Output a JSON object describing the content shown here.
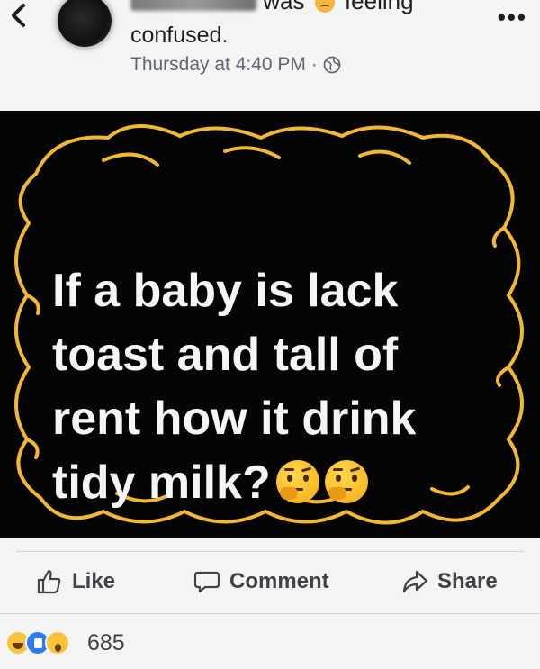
{
  "header": {
    "back_icon": "chevron-left-icon",
    "top_line_was": "was",
    "top_line_feeling": "feeling",
    "feeling_label": "confused.",
    "timestamp": "Thursday at 4:40 PM ·",
    "privacy_icon": "globe-icon",
    "more_label": "•••"
  },
  "post": {
    "image_text_lines": "If a baby is lack\ntoast and tall of\nrent how it drink\ntidy milk?",
    "emoji_count": 2,
    "frame_color": "#f2b733",
    "background_color": "#050505",
    "text_color": "#f5f5f5"
  },
  "actions": {
    "like_label": "Like",
    "comment_label": "Comment",
    "share_label": "Share"
  },
  "reactions": {
    "icons": [
      "haha",
      "like",
      "wow"
    ],
    "count": "685"
  }
}
